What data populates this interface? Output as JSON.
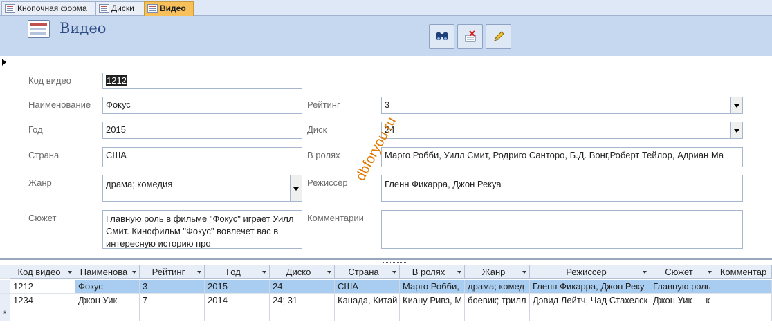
{
  "tabs": [
    {
      "label": "Кнопочная форма",
      "active": false
    },
    {
      "label": "Диски",
      "active": false
    },
    {
      "label": "Видео",
      "active": true
    }
  ],
  "form": {
    "title": "Видео",
    "toolbar": {
      "find_icon": "binoculars-icon",
      "delete_icon": "delete-record-icon",
      "edit_icon": "pencil-icon"
    },
    "fields": {
      "code_label": "Код видео",
      "code_value": "1212",
      "name_label": "Наименование",
      "name_value": "Фокус",
      "year_label": "Год",
      "year_value": "2015",
      "country_label": "Страна",
      "country_value": "США",
      "genre_label": "Жанр",
      "genre_value": "драма; комедия",
      "plot_label": "Сюжет",
      "plot_value": "Главную роль в фильме \"Фокус\" играет Уилл Смит.  Кинофильм \"Фокус\" вовлечет вас в интересную историю про",
      "rating_label": "Рейтинг",
      "rating_value": "3",
      "disk_label": "Диск",
      "disk_value": "24",
      "cast_label": "В ролях",
      "cast_value": "Марго Робби, Уилл Смит, Родриго Санторо, Б.Д. Вонг,Роберт Тейлор, Адриан Ма",
      "director_label": "Режиссёр",
      "director_value": "Гленн Фикарра, Джон Рекуа",
      "comments_label": "Комментарии",
      "comments_value": ""
    },
    "watermark": "dbforyou.ru"
  },
  "grid": {
    "columns": [
      "Код видео",
      "Наименова",
      "Рейтинг",
      "Год",
      "Диско",
      "Страна",
      "В ролях",
      "Жанр",
      "Режиссёр",
      "Сюжет",
      "Комментар"
    ],
    "rows": [
      [
        "1212",
        "Фокус",
        "3",
        "2015",
        "24",
        "США",
        "Марго Робби,",
        "драма; комед",
        "Гленн Фикарра, Джон Реку",
        "Главную роль",
        ""
      ],
      [
        "1234",
        "Джон Уик",
        "7",
        "2014",
        "24; 31",
        "Канада, Китай",
        "Киану Ривз, М",
        "боевик; трилл",
        "Дэвид Лейтч, Чад Стахелск",
        "Джон Уик — к",
        ""
      ]
    ],
    "new_row_marker": "*"
  }
}
